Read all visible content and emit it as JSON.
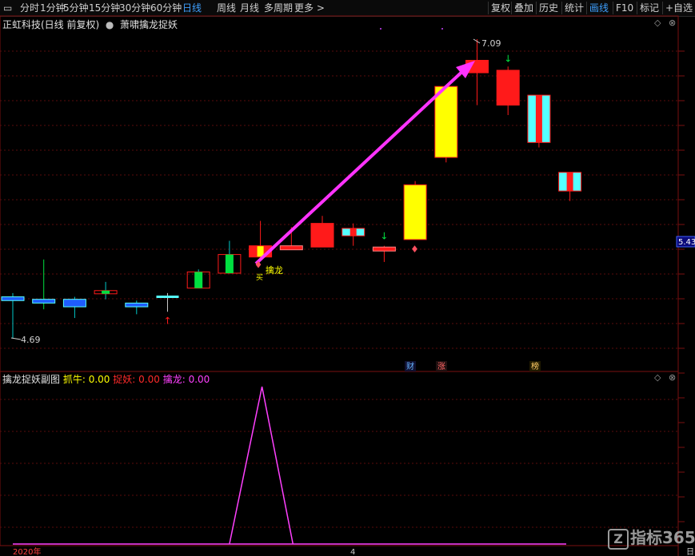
{
  "toolbar": {
    "periods": [
      "分时",
      "1分钟",
      "5分钟",
      "15分钟",
      "30分钟",
      "60分钟",
      "日线",
      "周线",
      "月线",
      "多周期",
      "更多 >"
    ],
    "active_period": "日线",
    "right_buttons": [
      "复权",
      "叠加",
      "历史",
      "统计",
      "画线",
      "F10",
      "标记",
      "+自选"
    ],
    "active_right": "画线"
  },
  "main_title": {
    "stock": "正虹科技(日线 前复权)",
    "indicator": "萧啸擒龙捉妖"
  },
  "sub_title": {
    "name": "擒龙捉妖副图",
    "l1": "抓牛:",
    "v1": "0.00",
    "l2": "捉妖:",
    "v2": "0.00",
    "l3": "擒龙:",
    "v3": "0.00"
  },
  "annotations": {
    "high": "7.09",
    "low": "4.69",
    "price_tag": "5.43",
    "qinlong": "擒龙",
    "mai": "买",
    "badge_cai": "财",
    "badge_zhang": "涨",
    "badge_bang": "榜"
  },
  "axis": {
    "year": "2020年",
    "month": "4",
    "right_end": "日"
  },
  "logo": {
    "text": "指标365",
    "z": "Z"
  },
  "colors": {
    "up": "#ff1a1a",
    "down": "#1e5cff",
    "cyan": "#55ffff",
    "yellow": "#ffff00",
    "magenta": "#ff40ff",
    "green": "#00e040"
  },
  "chart_data": {
    "type": "candlestick",
    "price_range": [
      4.69,
      7.09
    ],
    "candles": [
      {
        "o": 5.02,
        "c": 4.99,
        "h": 5.05,
        "l": 4.69,
        "body": "blue"
      },
      {
        "o": 5.0,
        "c": 4.97,
        "h": 5.32,
        "l": 4.92,
        "body": "blue"
      },
      {
        "o": 5.0,
        "c": 4.94,
        "h": 5.02,
        "l": 4.85,
        "body": "blue"
      },
      {
        "o": 5.05,
        "c": 5.07,
        "h": 5.14,
        "l": 5.0,
        "body": "green"
      },
      {
        "o": 4.97,
        "c": 4.94,
        "h": 4.99,
        "l": 4.88,
        "body": "blue"
      },
      {
        "o": 5.02,
        "c": 5.03,
        "h": 5.05,
        "l": 4.9,
        "body": "cyan"
      },
      {
        "o": 5.09,
        "c": 5.22,
        "h": 5.24,
        "l": 5.09,
        "body": "green"
      },
      {
        "o": 5.21,
        "c": 5.36,
        "h": 5.47,
        "l": 5.21,
        "body": "green"
      },
      {
        "o": 5.34,
        "c": 5.43,
        "h": 5.63,
        "l": 5.34,
        "body": "yellowred"
      },
      {
        "o": 5.41,
        "c": 5.43,
        "h": 5.58,
        "l": 5.41,
        "body": "redline"
      },
      {
        "o": 5.42,
        "c": 5.61,
        "h": 5.67,
        "l": 5.42,
        "body": "red"
      },
      {
        "o": 5.51,
        "c": 5.57,
        "h": 5.61,
        "l": 5.43,
        "body": "cyanred"
      },
      {
        "o": 5.4,
        "c": 5.42,
        "h": 5.43,
        "l": 5.3,
        "body": "redline"
      },
      {
        "o": 5.48,
        "c": 5.92,
        "h": 5.95,
        "l": 5.48,
        "body": "yellow"
      },
      {
        "o": 6.14,
        "c": 6.71,
        "h": 6.71,
        "l": 6.1,
        "body": "yellow"
      },
      {
        "o": 6.82,
        "c": 6.92,
        "h": 7.09,
        "l": 6.56,
        "body": "red"
      },
      {
        "o": 6.56,
        "c": 6.84,
        "h": 6.87,
        "l": 6.48,
        "body": "red"
      },
      {
        "o": 6.26,
        "c": 6.64,
        "h": 6.64,
        "l": 6.22,
        "body": "cyanred"
      },
      {
        "o": 5.87,
        "c": 6.02,
        "h": 6.02,
        "l": 5.79,
        "body": "cyanred"
      }
    ],
    "sub_series": {
      "name": "擒龙",
      "peak_index": 8,
      "values": [
        0,
        0,
        0,
        0,
        0,
        0,
        0,
        0,
        1,
        0,
        0,
        0,
        0,
        0,
        0,
        0,
        0,
        0,
        0
      ]
    }
  }
}
